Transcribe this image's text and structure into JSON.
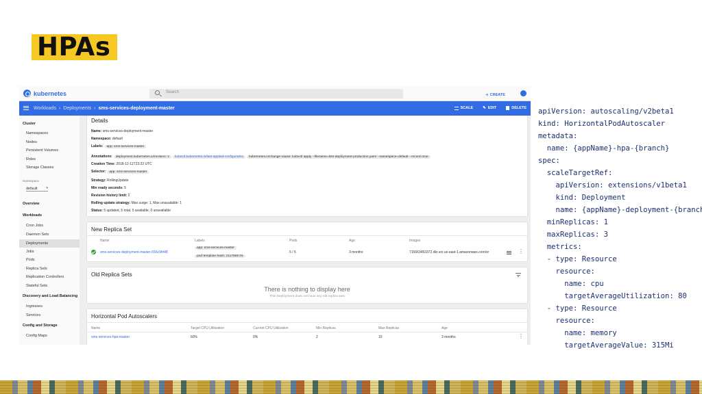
{
  "slide": {
    "title": "HPAs"
  },
  "topbar": {
    "brand": "kubernetes",
    "search_placeholder": "Search",
    "create_label": "CREATE"
  },
  "bluebar": {
    "crumbs": [
      "Workloads",
      "Deployments",
      "sms-services-deployment-master"
    ],
    "actions": {
      "scale": "SCALE",
      "edit": "EDIT",
      "delete": "DELETE"
    }
  },
  "sidebar": {
    "cluster": "Cluster",
    "cluster_items": [
      "Namespaces",
      "Nodes",
      "Persistent Volumes",
      "Roles",
      "Storage Classes"
    ],
    "namespace_label": "Namespace",
    "namespace_value": "default",
    "overview": "Overview",
    "workloads": "Workloads",
    "workload_items": [
      "Cron Jobs",
      "Daemon Sets",
      "Deployments",
      "Jobs",
      "Pods",
      "Replica Sets",
      "Replication Controllers",
      "Stateful Sets"
    ],
    "discovery": "Discovery and Load Balancing",
    "discovery_items": [
      "Ingresses",
      "Services"
    ],
    "config": "Config and Storage",
    "config_items": [
      "Config Maps"
    ]
  },
  "details": {
    "title": "Details",
    "name_label": "Name:",
    "name": "sms-services-deployment-master",
    "namespace_label": "Namespace:",
    "namespace": "default",
    "labels_label": "Labels:",
    "label_chip": "app: sms-services-master",
    "annotations_label": "Annotations:",
    "annotation_1": "deployment.kubernetes.io/revision: 2",
    "annotation_2": "kubectl.kubernetes.io/last-applied-configuration",
    "annotation_3": "kubernetes.io/change-cause: kubectl apply --filename=k8s-deployment-production.yaml --namespace=default --record=true",
    "creation_label": "Creation Time:",
    "creation": "2018-12-11T23:23 UTC",
    "selector_label": "Selector:",
    "selector": "app: sms-services-master",
    "strategy_label": "Strategy:",
    "strategy": "RollingUpdate",
    "minready_label": "Min ready seconds:",
    "minready": "5",
    "revlimit_label": "Revision history limit:",
    "revlimit": "2",
    "rolling_label": "Rolling update strategy:",
    "rolling": "Max surge: 1, Max unavailable: 1",
    "status_label": "Status:",
    "status": "5 updated, 5 total, 5 available, 0 unavailable"
  },
  "new_replica_set": {
    "title": "New Replica Set",
    "headers": {
      "name": "Name",
      "labels": "Labels",
      "pods": "Pods",
      "age": "Age",
      "images": "Images"
    },
    "row": {
      "name": "sms-services-deployment-master-655c9bf48",
      "label_1": "app: sms-services-master",
      "label_2": "pod-template-hash: 2117569 04",
      "pods": "5 / 5",
      "age": "3 months",
      "images": "715663453372.dkr.ecr.us-east-1.amazonaws.com/sr"
    }
  },
  "old_replica_sets": {
    "title": "Old Replica Sets",
    "empty_title": "There is nothing to display here",
    "empty_sub": "This Deployment does not have any old replica sets"
  },
  "hpa": {
    "title": "Horizontal Pod Autoscalers",
    "headers": {
      "name": "Name",
      "target": "Target CPU Utilization",
      "current": "Current CPU Utilization",
      "min": "Min Replicas",
      "max": "Max Replicas",
      "age": "Age"
    },
    "row": {
      "name": "sms-services-hpa-master",
      "target": "60%",
      "current": "0%",
      "min": "2",
      "max": "10",
      "age": "3 months"
    }
  },
  "yaml_lines": [
    "apiVersion: autoscaling/v2beta1",
    "kind: HorizontalPodAutoscaler",
    "metadata:",
    "  name: {appName}-hpa-{branch}",
    "spec:",
    "  scaleTargetRef:",
    "    apiVersion: extensions/v1beta1",
    "    kind: Deployment",
    "    name: {appName}-deployment-{branch}",
    "  minReplicas: 1",
    "  maxReplicas: 3",
    "  metrics:",
    "  - type: Resource",
    "    resource:",
    "      name: cpu",
    "      targetAverageUtilization: 80",
    "  - type: Resource",
    "    resource:",
    "      name: memory",
    "      targetAverageValue: 315Mi"
  ]
}
